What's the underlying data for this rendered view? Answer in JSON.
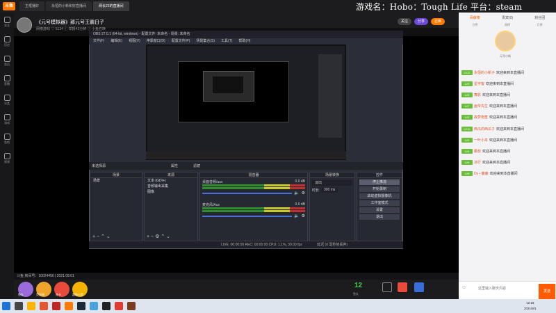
{
  "browser": {
    "logo": "斗鱼",
    "tabs": [
      "主框播好",
      "永恒的小新和好直播间",
      "网长23的直播间"
    ],
    "active_tab": 2
  },
  "overlay_title": "游戏名：Hobo：Tough Life 平台：steam",
  "leftnav": [
    "关注",
    "历史",
    "首页",
    "直播",
    "分类",
    "游戏",
    "鱼吧",
    "视频"
  ],
  "header": {
    "title": "《元号模拟器》那元号王霸日子",
    "sub": "网络游戏    ♡ 5134    ⓘ 举报43分钟    ⓘ 小鱼召唤",
    "buttons": [
      "关注",
      "分享",
      "召唤"
    ]
  },
  "obs": {
    "title": "OBS 27.0.1 (64-bit, windows) - 配置文件: 未命名 - 场景: 未命名",
    "menu": [
      "文件(F)",
      "编辑(E)",
      "视图(V)",
      "停靠窗口(D)",
      "配置文件(P)",
      "场景集合(S)",
      "工具(T)",
      "帮助(H)"
    ],
    "scene_bar": "未选择源",
    "scene_bar_btns": [
      "属性",
      "滤镜"
    ],
    "scenes_header": "场景",
    "scenes": [
      "场景"
    ],
    "sources_header": "来源",
    "sources": [
      "文本 (GDI+)",
      "音频输出采集",
      "图像"
    ],
    "mixer_header": "混音器",
    "mixer": [
      {
        "name": "桌面音频/aux",
        "db": "0.0 dB"
      },
      {
        "name": "麦克风/Aux",
        "db": "0.0 dB"
      }
    ],
    "transition_header": "场景转换",
    "transition": {
      "type": "淡出",
      "duration_label": "时长",
      "duration": "300 ms"
    },
    "controls_header": "控件",
    "controls": [
      "停止推流",
      "开始录制",
      "启动虚拟摄像机",
      "工作室模式",
      "设置",
      "退出"
    ],
    "status": "LIVE: 00:00:00    REC: 00:00:00    CPU: 1.1%, 30.00 fps",
    "status_extra": "延迟 (0 毫秒帧丢弃)"
  },
  "room_info": "斗鱼 房间号：10024456 | 2021.09.01",
  "gifts": [
    {
      "label": "鱼丸",
      "color": "#9a6cd9"
    },
    {
      "label": "荧光棒",
      "color": "#f1a42b"
    },
    {
      "label": "办卡",
      "color": "#e84a3c"
    },
    {
      "label": "超级火箭",
      "color": "#f3b300"
    }
  ],
  "fishball_count": "12",
  "fishball_label": "鱼丸",
  "chat": {
    "tabs": [
      "贡献榜",
      "贵宾(0)",
      "粉丝团"
    ],
    "active_tab": 0,
    "subtabs": [
      "日榜",
      "周榜",
      "月榜"
    ],
    "top_name": "元号小新",
    "messages": [
      {
        "lvl": "LV12",
        "user": "永恒的小新子",
        "text": "欢迎来到本直播间"
      },
      {
        "lvl": "LV9",
        "user": "星宇客",
        "text": "欢迎来到本直播间"
      },
      {
        "lvl": "LV5",
        "user": "舞影",
        "text": "欢迎来到本直播间"
      },
      {
        "lvl": "LV7",
        "user": "画爷先生",
        "text": "欢迎来到本直播间"
      },
      {
        "lvl": "LV3",
        "user": "故梦南笙",
        "text": "欢迎来到本直播间"
      },
      {
        "lvl": "LV10",
        "user": "西瓜的西瓜子",
        "text": "欢迎来到本直播间"
      },
      {
        "lvl": "LV2",
        "user": "一叶小舟",
        "text": "欢迎来到本直播间"
      },
      {
        "lvl": "LV4",
        "user": "霸叔",
        "text": "欢迎来到本直播间"
      },
      {
        "lvl": "LV6",
        "user": "凉行",
        "text": "欢迎来到本直播间"
      },
      {
        "lvl": "LV8",
        "user": "Dy • 鹿鹿",
        "text": "欢迎来到本直播间"
      }
    ],
    "input_placeholder": "这里输入聊天内容",
    "send": "发送"
  },
  "clock": {
    "time": "12:18",
    "date": "2021/9/1"
  }
}
